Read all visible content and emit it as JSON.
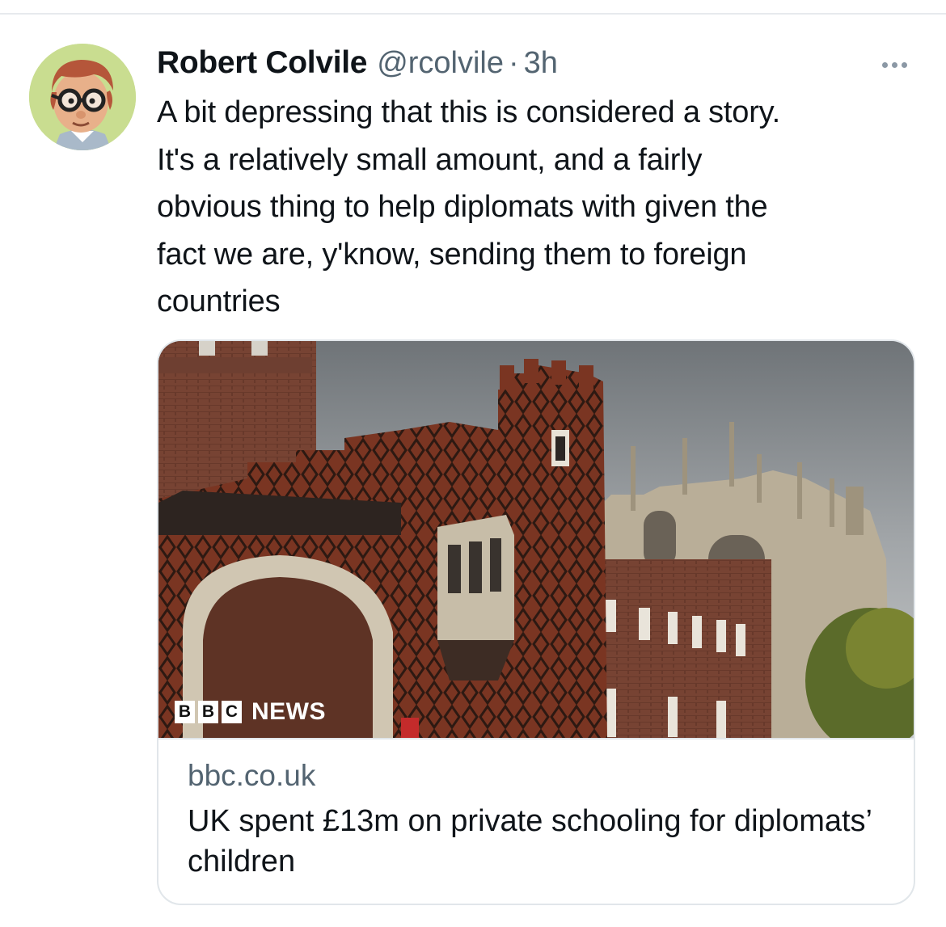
{
  "tweet": {
    "author_name": "Robert Colvile",
    "author_handle": "@rcolvile",
    "separator": "·",
    "timestamp": "3h",
    "text": "A bit depressing that this is considered a story.\nIt's a relatively small amount, and a fairly\nobvious thing to help diplomats with given the\nfact we are, y'know, sending them to foreign\ncountries"
  },
  "card": {
    "brand_blocks": [
      "B",
      "B",
      "C"
    ],
    "brand_word": "NEWS",
    "domain": "bbc.co.uk",
    "title": "UK spent £13m on private schooling for diplomats’ children"
  },
  "icons": {
    "avatar": "avatar-cartoon-glasses",
    "more": "more-options-icon"
  },
  "colors": {
    "text_primary": "#0f1419",
    "text_secondary": "#536471",
    "border": "#e1e6ea",
    "brick": "#7a3a26",
    "stone": "#c2b8a3",
    "sky": "#8e9397"
  }
}
